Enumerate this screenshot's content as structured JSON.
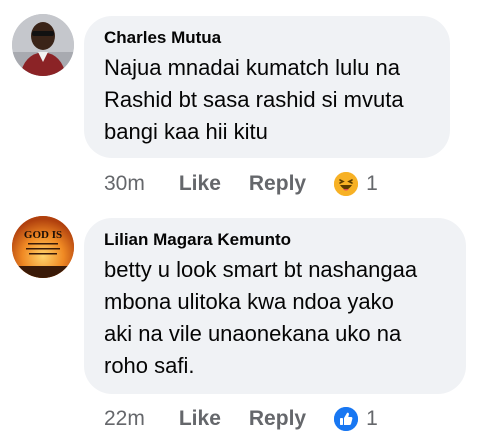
{
  "comments": [
    {
      "author": "Charles Mutua",
      "text": "Najua mnadai kumatch lulu na\nRashid bt sasa rashid si mvuta\nbangi kaa hii kitu",
      "time": "30m",
      "like_label": "Like",
      "reply_label": "Reply",
      "reaction_icon": "haha-icon",
      "reaction_count": "1"
    },
    {
      "author": "Lilian Magara Kemunto",
      "avatar_text": "GOD IS",
      "text": "betty u look smart bt nashangaa\nmbona ulitoka kwa ndoa yako\naki na vile  unaonekana uko na\nroho safi.",
      "time": "22m",
      "like_label": "Like",
      "reply_label": "Reply",
      "reaction_icon": "like-icon",
      "reaction_count": "1"
    }
  ],
  "colors": {
    "bubble": "#f0f2f5",
    "secondary_text": "#65676b",
    "like_blue": "#1877f2",
    "haha_yellow": "#f7b125"
  }
}
